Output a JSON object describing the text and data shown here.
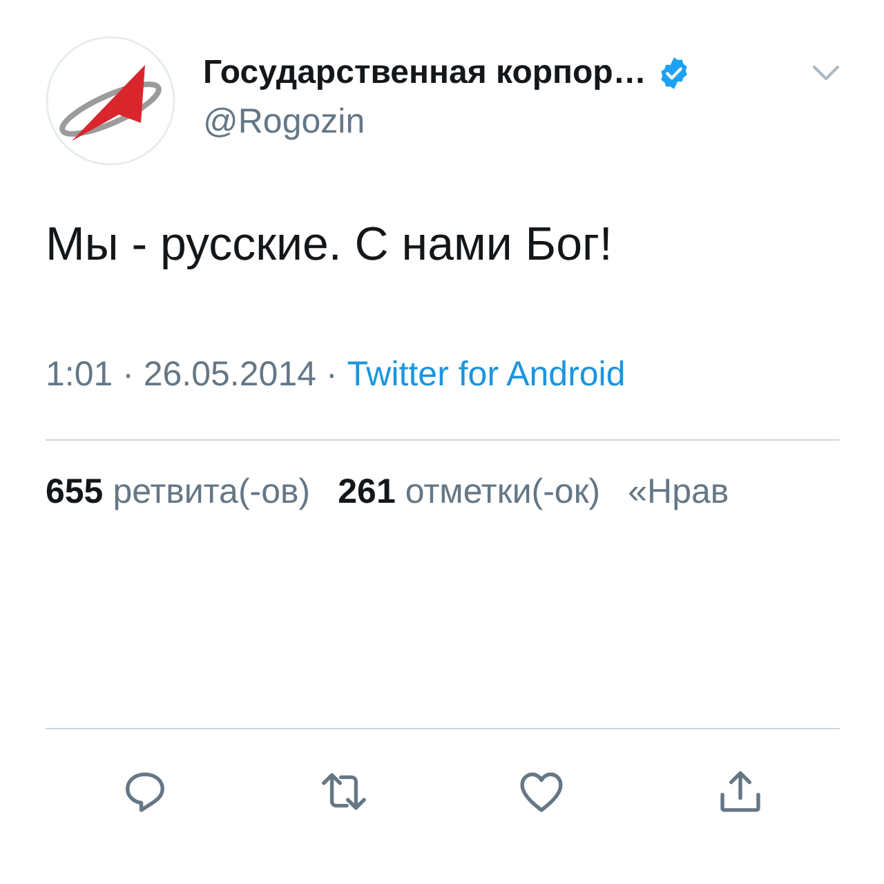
{
  "author": {
    "name": "Государственная корпор…",
    "verified": true,
    "handle": "@Rogozin"
  },
  "tweet": {
    "text": "Мы - русские. С нами Бог!"
  },
  "meta": {
    "timestamp": "1:01 · 26.05.2014 ·",
    "source": "Twitter for Android"
  },
  "stats": [
    {
      "count": "655",
      "label": "ретвита(-ов)"
    },
    {
      "count": "261",
      "label": "отметки(-ок)"
    },
    {
      "label": "«Нрав"
    }
  ]
}
